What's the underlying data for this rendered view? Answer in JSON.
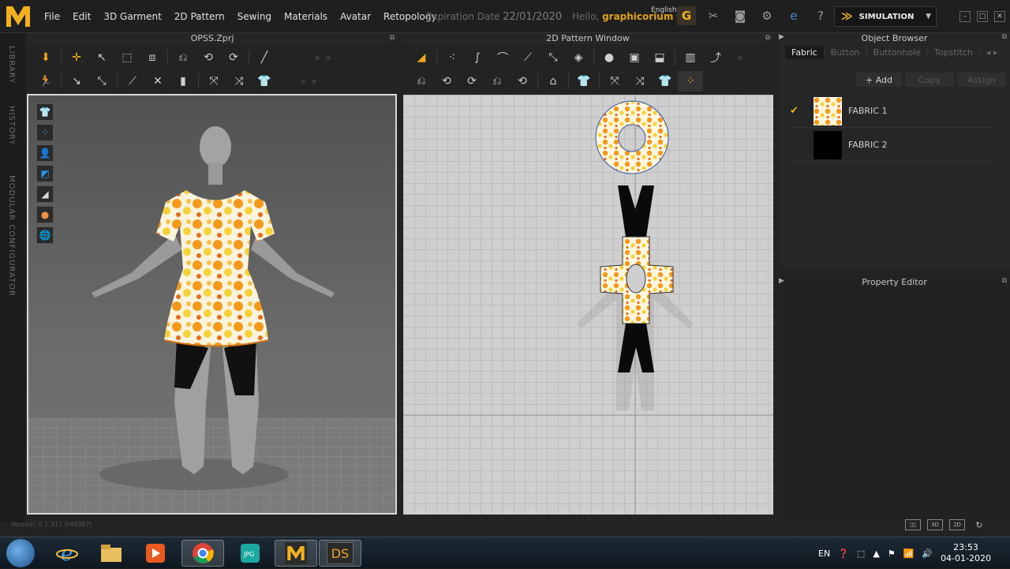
{
  "menu": [
    "File",
    "Edit",
    "3D Garment",
    "2D Pattern",
    "Sewing",
    "Materials",
    "Avatar",
    "Retopology"
  ],
  "expiration": {
    "label": "Expiration Date",
    "date": "22/01/2020"
  },
  "hello": {
    "label": "Hello,",
    "user": "graphicorium"
  },
  "language": "English",
  "simulation_label": "SIMULATION",
  "panel3d_title": "OPSS.Zprj",
  "panel2d_title": "2D Pattern Window",
  "object_browser": {
    "title": "Object Browser",
    "tabs": [
      "Fabric",
      "Button",
      "Buttonhole",
      "Topstitch"
    ],
    "buttons": {
      "add": "+ Add",
      "copy": "Copy",
      "assign": "Assign"
    },
    "fabrics": [
      {
        "name": "FABRIC 1",
        "selected": true
      },
      {
        "name": "FABRIC 2",
        "selected": false
      }
    ]
  },
  "property_editor_title": "Property Editor",
  "sidebar_tabs": [
    "LIBRARY",
    "HISTORY",
    "MODULAR CONFIGURATOR"
  ],
  "version": "Version: 5.1.311 (r44087)",
  "view_modes": [
    "3D",
    "2D"
  ],
  "taskbar": {
    "lang": "EN",
    "time": "23:53",
    "date": "04-01-2020",
    "apps": [
      "DS"
    ]
  },
  "colors": {
    "accent": "#f0b020",
    "print_orange": "#f39a1c",
    "print_yellow": "#f6d23a"
  }
}
